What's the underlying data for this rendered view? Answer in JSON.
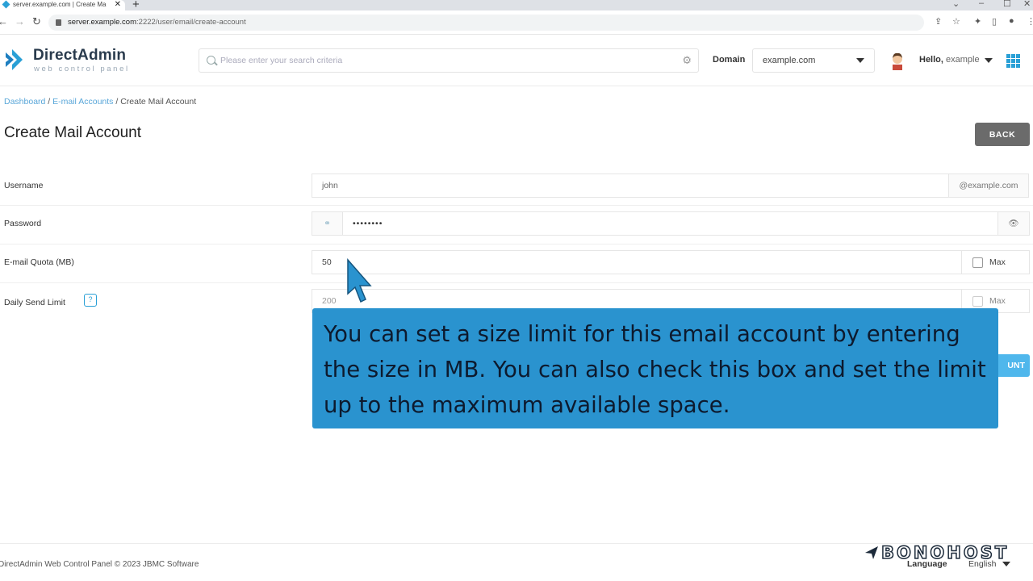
{
  "browser": {
    "tab_title": "server.example.com | Create Ma",
    "url_host": "server.example.com",
    "url_path": ":2222/user/email/create-account"
  },
  "header": {
    "logo_title": "DirectAdmin",
    "logo_subtitle": "web control panel",
    "search_placeholder": "Please enter your search criteria",
    "domain_label": "Domain",
    "domain_value": "example.com",
    "hello_prefix": "Hello,",
    "hello_user": "example"
  },
  "breadcrumb": {
    "items": [
      "Dashboard",
      "E-mail Accounts",
      "Create Mail Account"
    ],
    "separator": "/"
  },
  "page": {
    "title": "Create Mail Account",
    "back_label": "BACK",
    "create_label": "UNT"
  },
  "form": {
    "username_label": "Username",
    "username_value": "john",
    "username_suffix": "@example.com",
    "password_label": "Password",
    "password_value": "••••••••",
    "quota_label": "E-mail Quota (MB)",
    "quota_value": "50",
    "quota_max_label": "Max",
    "send_limit_label": "Daily Send Limit",
    "send_limit_value": "200",
    "send_limit_max_label": "Max",
    "help_label": "?"
  },
  "tooltip": {
    "text": "You can set a size limit for this email account by entering the size in MB. You can also check this box and set the limit up to the maximum available space."
  },
  "footer": {
    "copyright": "DirectAdmin Web Control Panel © 2023 JBMC Software",
    "language_label": "Language",
    "language_value": "English",
    "watermark": "BONOHOST"
  },
  "colors": {
    "accent": "#2aa0d6",
    "tooltip_bg": "#2a93cf",
    "back_button": "#6b6b6b",
    "create_button": "#4fb7ec"
  }
}
